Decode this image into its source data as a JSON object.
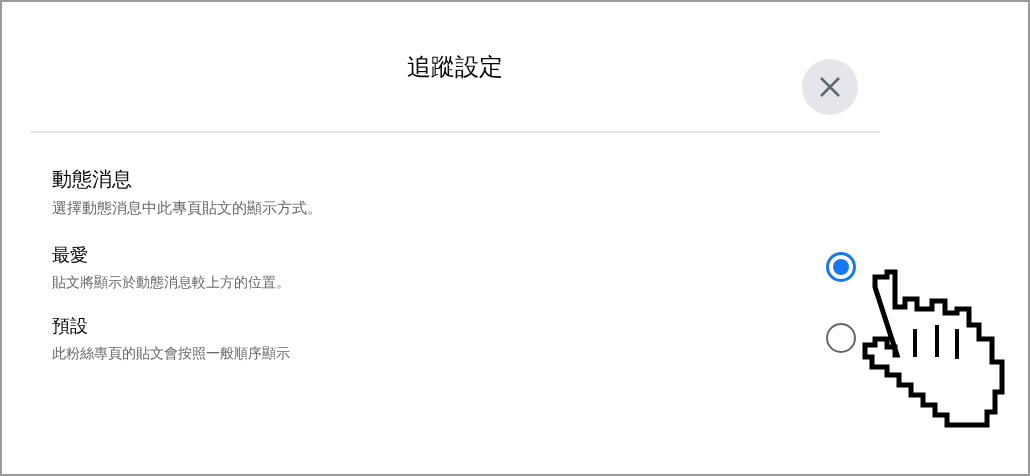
{
  "dialog": {
    "title": "追蹤設定"
  },
  "section": {
    "heading": "動態消息",
    "description": "選擇動態消息中此專頁貼文的顯示方式。"
  },
  "options": [
    {
      "label": "最愛",
      "description": "貼文將顯示於動態消息較上方的位置。",
      "selected": true
    },
    {
      "label": "預設",
      "description": "此粉絲專頁的貼文會按照一般順序顯示",
      "selected": false
    }
  ]
}
